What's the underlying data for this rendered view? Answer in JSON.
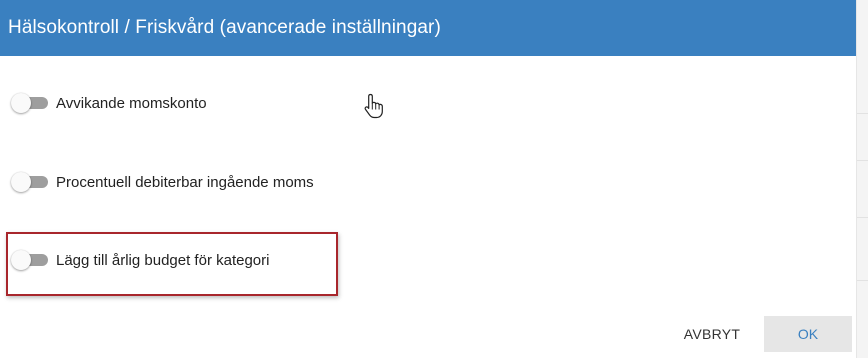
{
  "dialog": {
    "title": "Hälsokontroll / Friskvård (avancerade inställningar)"
  },
  "settings": [
    {
      "label": "Avvikande momskonto",
      "enabled": false
    },
    {
      "label": "Procentuell debiterbar ingående moms",
      "enabled": false
    },
    {
      "label": "Lägg till årlig budget för kategori",
      "enabled": false,
      "highlighted": true
    }
  ],
  "actions": {
    "cancel_label": "AVBRYT",
    "ok_label": "OK"
  },
  "colors": {
    "header": "#3a80c0",
    "highlight": "#a8262c",
    "toggle_off_track": "#9e9e9e"
  },
  "icons": {
    "cursor": "hand-pointer-icon"
  }
}
